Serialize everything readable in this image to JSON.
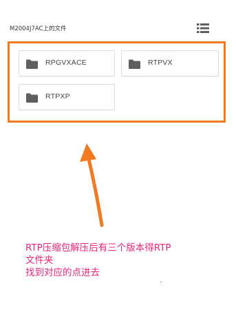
{
  "header": {
    "title": "M2004J7AC上的文件",
    "view_toggle_icon": "list-view-icon"
  },
  "folders": [
    {
      "name": "RPGVXACE",
      "icon": "folder-icon"
    },
    {
      "name": "RTPVX",
      "icon": "folder-icon"
    },
    {
      "name": "RTPXP",
      "icon": "folder-icon"
    }
  ],
  "annotation": {
    "lines": [
      "RTP压缩包解压后有三个版本得RTP",
      "文件夹",
      "找到对应的点进去"
    ],
    "color": "#e8257a"
  },
  "colors": {
    "highlight": "#f07b22",
    "arrow": "#f07b22",
    "folder_icon": "#5f5f5f"
  }
}
